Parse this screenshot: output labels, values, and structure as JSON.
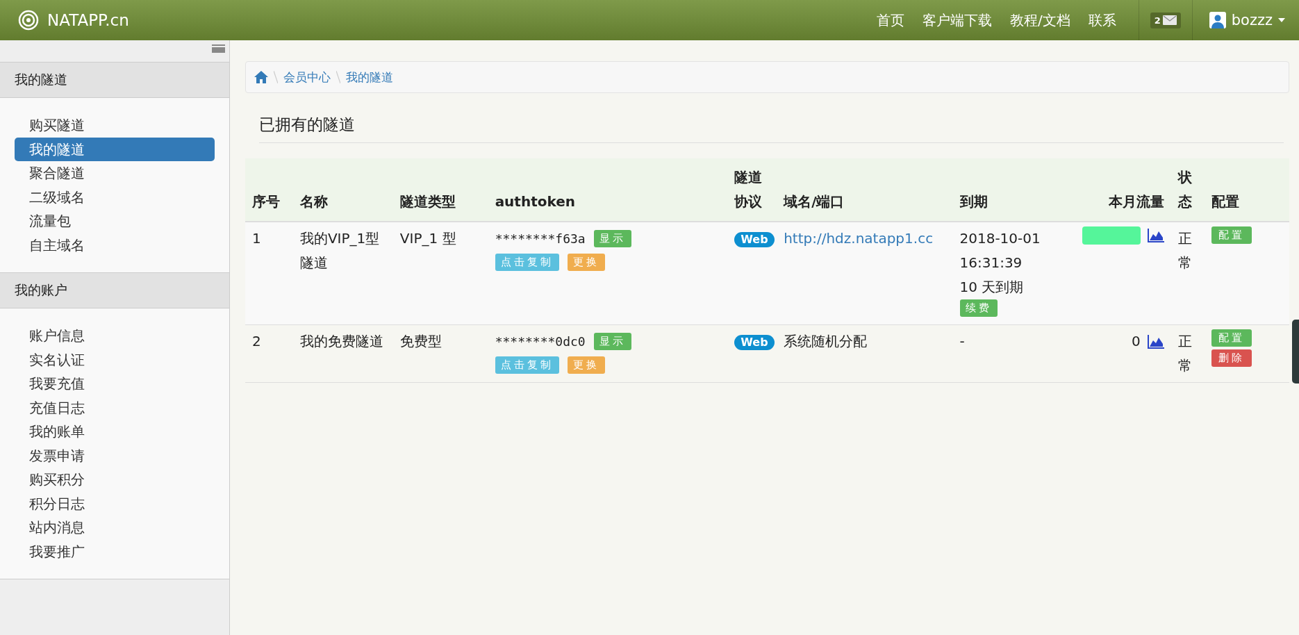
{
  "header": {
    "brand": "NATAPP.cn",
    "nav": [
      "首页",
      "客户端下载",
      "教程/文档",
      "联系"
    ],
    "message_count": "2",
    "user": "bozzz"
  },
  "sidebar": {
    "sections": [
      {
        "title": "我的隧道",
        "items": [
          {
            "label": "购买隧道",
            "selected": false
          },
          {
            "label": "我的隧道",
            "selected": true
          },
          {
            "label": "聚合隧道",
            "selected": false
          },
          {
            "label": "二级域名",
            "selected": false
          },
          {
            "label": "流量包",
            "selected": false
          },
          {
            "label": "自主域名",
            "selected": false
          }
        ]
      },
      {
        "title": "我的账户",
        "items": [
          {
            "label": "账户信息",
            "selected": false
          },
          {
            "label": "实名认证",
            "selected": false
          },
          {
            "label": "我要充值",
            "selected": false
          },
          {
            "label": "充值日志",
            "selected": false
          },
          {
            "label": "我的账单",
            "selected": false
          },
          {
            "label": "发票申请",
            "selected": false
          },
          {
            "label": "购买积分",
            "selected": false
          },
          {
            "label": "积分日志",
            "selected": false
          },
          {
            "label": "站内消息",
            "selected": false
          },
          {
            "label": "我要推广",
            "selected": false
          }
        ]
      }
    ]
  },
  "breadcrumb": [
    "会员中心",
    "我的隧道"
  ],
  "page_title": "已拥有的隧道",
  "table": {
    "columns": [
      "序号",
      "名称",
      "隧道类型",
      "authtoken",
      "隧道协议",
      "域名/端口",
      "到期",
      "本月流量",
      "状态",
      "配置"
    ],
    "rows": [
      {
        "index": "1",
        "name": "我的VIP_1型隧道",
        "type": "VIP_1 型",
        "token": "********f63a",
        "token_buttons": [
          {
            "label": "显示",
            "kind": "success"
          },
          {
            "label": "点击复制",
            "kind": "info"
          },
          {
            "label": "更换",
            "kind": "warning"
          }
        ],
        "protocol": "Web",
        "domain": {
          "text": "http://hdz.natapp1.cc",
          "kind": "link"
        },
        "expiry": {
          "date": "2018-10-01 16:31:39",
          "remaining": "10 天到期",
          "button": {
            "label": "续费",
            "kind": "success"
          }
        },
        "traffic": {
          "kind": "meter",
          "level": 1
        },
        "status": "正常",
        "actions": [
          {
            "label": "配置",
            "kind": "success"
          }
        ]
      },
      {
        "index": "2",
        "name": "我的免费隧道",
        "type": "免费型",
        "token": "********0dc0",
        "token_buttons": [
          {
            "label": "显示",
            "kind": "success"
          },
          {
            "label": "点击复制",
            "kind": "info"
          },
          {
            "label": "更换",
            "kind": "warning"
          }
        ],
        "protocol": "Web",
        "domain": {
          "text": "系统随机分配",
          "kind": "text"
        },
        "expiry": {
          "date": "-"
        },
        "traffic": {
          "kind": "text",
          "text": "0"
        },
        "status": "正常",
        "actions": [
          {
            "label": "配置",
            "kind": "success"
          },
          {
            "label": "删除",
            "kind": "danger"
          }
        ]
      }
    ]
  }
}
